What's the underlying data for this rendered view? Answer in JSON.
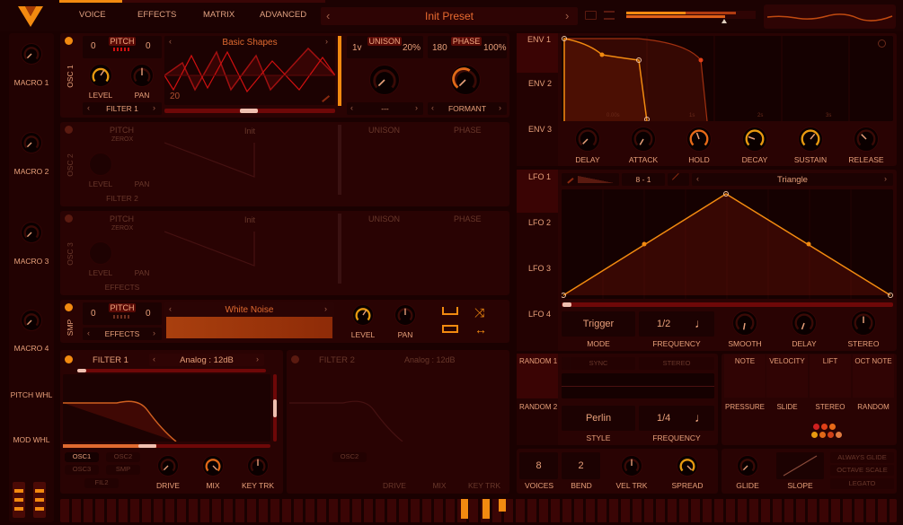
{
  "header": {
    "tabs": [
      "VOICE",
      "EFFECTS",
      "MATRIX",
      "ADVANCED"
    ],
    "preset": "Init Preset",
    "prev": "‹",
    "next": "›"
  },
  "macros": [
    "MACRO 1",
    "MACRO 2",
    "MACRO 3",
    "MACRO 4"
  ],
  "wheels": [
    "PITCH WHL",
    "MOD WHL"
  ],
  "osc1": {
    "name": "OSC 1",
    "pitch_label": "PITCH",
    "pitch_left": "0",
    "pitch_right": "0",
    "wave": "Basic Shapes",
    "frame": "20",
    "level": "LEVEL",
    "pan": "PAN",
    "dest": "FILTER 1",
    "unison": "UNISON",
    "voices": "1v",
    "detune": "20%",
    "phase": "PHASE",
    "phase_val": "180",
    "phase_amt": "100%",
    "spectral": "---",
    "distortion": "FORMANT"
  },
  "osc2": {
    "name": "OSC 2",
    "pitch_label": "PITCH",
    "sub": "ZEROX",
    "wave": "Init",
    "level": "LEVEL",
    "pan": "PAN",
    "dest": "FILTER 2",
    "unison": "UNISON",
    "phase": "PHASE"
  },
  "osc3": {
    "name": "OSC 3",
    "pitch_label": "PITCH",
    "sub": "ZEROX",
    "wave": "Init",
    "level": "LEVEL",
    "pan": "PAN",
    "dest": "EFFECTS",
    "unison": "UNISON",
    "phase": "PHASE"
  },
  "smp": {
    "name": "SMP",
    "pitch_label": "PITCH",
    "pitch_left": "0",
    "pitch_right": "0",
    "sample": "White Noise",
    "dest": "EFFECTS",
    "level": "LEVEL",
    "pan": "PAN"
  },
  "filter1": {
    "name": "FILTER 1",
    "model": "Analog : 12dB",
    "srcs": [
      "OSC1",
      "OSC2",
      "OSC3",
      "SMP",
      "FIL2"
    ],
    "drive": "DRIVE",
    "mix": "MIX",
    "keytrk": "KEY TRK"
  },
  "filter2": {
    "name": "FILTER 2",
    "model": "Analog : 12dB",
    "srcs": [
      "OSC2"
    ],
    "drive": "DRIVE",
    "mix": "MIX",
    "keytrk": "KEY TRK"
  },
  "env": {
    "tabs": [
      "ENV 1",
      "ENV 2",
      "ENV 3"
    ],
    "ticks": [
      "0.00s",
      "1s",
      "2s",
      "3s"
    ],
    "knobs": [
      "DELAY",
      "ATTACK",
      "HOLD",
      "DECAY",
      "SUSTAIN",
      "RELEASE"
    ]
  },
  "lfo": {
    "tabs": [
      "LFO 1",
      "LFO 2",
      "LFO 3",
      "LFO 4"
    ],
    "grid": "8 - 1",
    "shape": "Triangle",
    "mode": "Trigger",
    "mode_label": "MODE",
    "freq": "1/2",
    "freq_label": "FREQUENCY",
    "knobs": [
      "SMOOTH",
      "DELAY",
      "STEREO"
    ]
  },
  "random": {
    "tabs": [
      "RANDOM 1",
      "RANDOM 2"
    ],
    "sync": "SYNC",
    "stereo": "STEREO",
    "style": "Perlin",
    "style_label": "STYLE",
    "freq": "1/4",
    "freq_label": "FREQUENCY"
  },
  "keymod": {
    "labels": [
      "NOTE",
      "VELOCITY",
      "LIFT",
      "OCT NOTE",
      "PRESSURE",
      "SLIDE",
      "STEREO",
      "RANDOM"
    ]
  },
  "voice": {
    "voices": "8",
    "voices_label": "VOICES",
    "bend": "2",
    "bend_label": "BEND",
    "veltrk": "VEL TRK",
    "spread": "SPREAD",
    "glide": "GLIDE",
    "slope": "SLOPE",
    "always_glide": "ALWAYS GLIDE",
    "octave_scale": "OCTAVE SCALE",
    "legato": "LEGATO"
  },
  "colors": {
    "accent": "#f28a10",
    "bg": "#1a0101",
    "panel": "#290303",
    "text": "#e8a07a"
  }
}
